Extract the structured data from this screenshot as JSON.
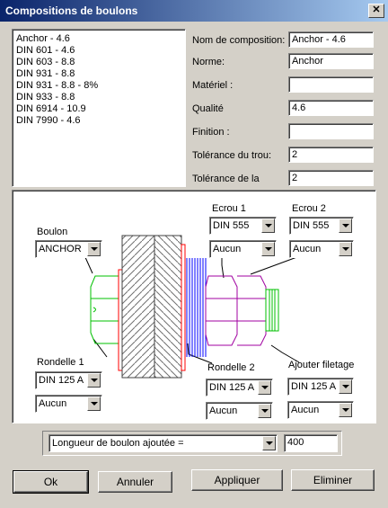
{
  "window": {
    "title": "Compositions de boulons",
    "close_glyph": "✕"
  },
  "list": {
    "items": [
      "Anchor - 4.6",
      "DIN 601 - 4.6",
      "DIN 603 - 8.8",
      "DIN 931 - 8.8",
      "DIN 931 - 8.8 - 8%",
      "DIN 933 - 8.8",
      "DIN 6914 - 10.9",
      "DIN 7990 - 4.6"
    ]
  },
  "props": {
    "nom_label": "Nom de composition:",
    "nom_value": "Anchor - 4.6",
    "norme_label": "Norme:",
    "norme_value": "Anchor",
    "materiel_label": "Matériel :",
    "materiel_value": "",
    "qualite_label": "Qualité",
    "qualite_value": "4.6",
    "finition_label": "Finition :",
    "finition_value": "",
    "tol_trou_label": "Tolérance du trou:",
    "tol_trou_value": "2",
    "tol_la_label": "Tolérance de la",
    "tol_la_value": "2"
  },
  "diagram": {
    "boulon_label": "Boulon",
    "boulon_value": "ANCHOR",
    "ecrou1_label": "Ecrou 1",
    "ecrou1_value": "DIN 555",
    "ecrou1_sub": "Aucun",
    "ecrou2_label": "Ecrou 2",
    "ecrou2_value": "DIN 555",
    "ecrou2_sub": "Aucun",
    "rondelle1_label": "Rondelle 1",
    "rondelle1_value": "DIN 125 A",
    "rondelle1_sub": "Aucun",
    "rondelle2_label": "Rondelle 2",
    "rondelle2_value": "DIN 125 A",
    "rondelle2_sub": "Aucun",
    "filetage_label": "Ajouter filetage",
    "filetage_value": "DIN 125 A",
    "filetage_sub": "Aucun",
    "colors": {
      "bolt": "#00c000",
      "washer": "#ff0000",
      "nut": "#a000a0",
      "thread": "#00c000",
      "spring": "#0000ff"
    }
  },
  "length": {
    "option": "Longueur de boulon ajoutée =",
    "value": "400"
  },
  "buttons": {
    "ok": "Ok",
    "annuler": "Annuler",
    "appliquer": "Appliquer",
    "eliminer": "Eliminer"
  }
}
